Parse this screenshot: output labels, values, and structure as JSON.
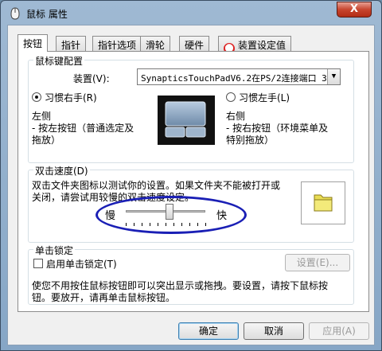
{
  "window": {
    "title": "鼠标 属性",
    "close_glyph": "X"
  },
  "tabs": [
    {
      "label": "按钮",
      "active": true
    },
    {
      "label": "指针"
    },
    {
      "label": "指针选项"
    },
    {
      "label": "滑轮"
    },
    {
      "label": "硬件"
    },
    {
      "label": "装置设定值",
      "icon": "touchpad-settings-icon"
    }
  ],
  "button_config": {
    "group_title": "鼠标键配置",
    "device_label": "装置(V):",
    "device_value": "SynapticsTouchPadV6.2在PS/2连接端口 3",
    "right_hand_label": "习惯右手(R)",
    "left_hand_label": "习惯左手(L)",
    "left_side_title": "左侧",
    "left_side_desc_1": "- 按左按钮（普通选定及",
    "left_side_desc_2": "拖放）",
    "right_side_title": "右侧",
    "right_side_desc_1": "- 按右按钮（环境菜单及",
    "right_side_desc_2": "特别拖放）"
  },
  "double_click": {
    "group_title": "双击速度(D)",
    "desc_1": "双击文件夹图标以测试你的设置。如果文件夹不能被打开或",
    "desc_2": "关闭，请尝试用较慢的双击速度设定。",
    "slow_label": "慢",
    "fast_label": "快",
    "speed_level": 0.55
  },
  "click_lock": {
    "group_title": "单击锁定",
    "checkbox_label": "启用单击锁定(T)",
    "settings_label": "设置(E)...",
    "desc_1": "使您不用按住鼠标按钮即可以突出显示或拖拽。要设置，请按下鼠标按",
    "desc_2": "钮。要放开，请再单击鼠标按钮。"
  },
  "footer": {
    "ok_label": "确定",
    "cancel_label": "取消",
    "apply_label": "应用(A)"
  },
  "colors": {
    "annotation": "#1a1fb5",
    "folder": "#e8dc54"
  }
}
